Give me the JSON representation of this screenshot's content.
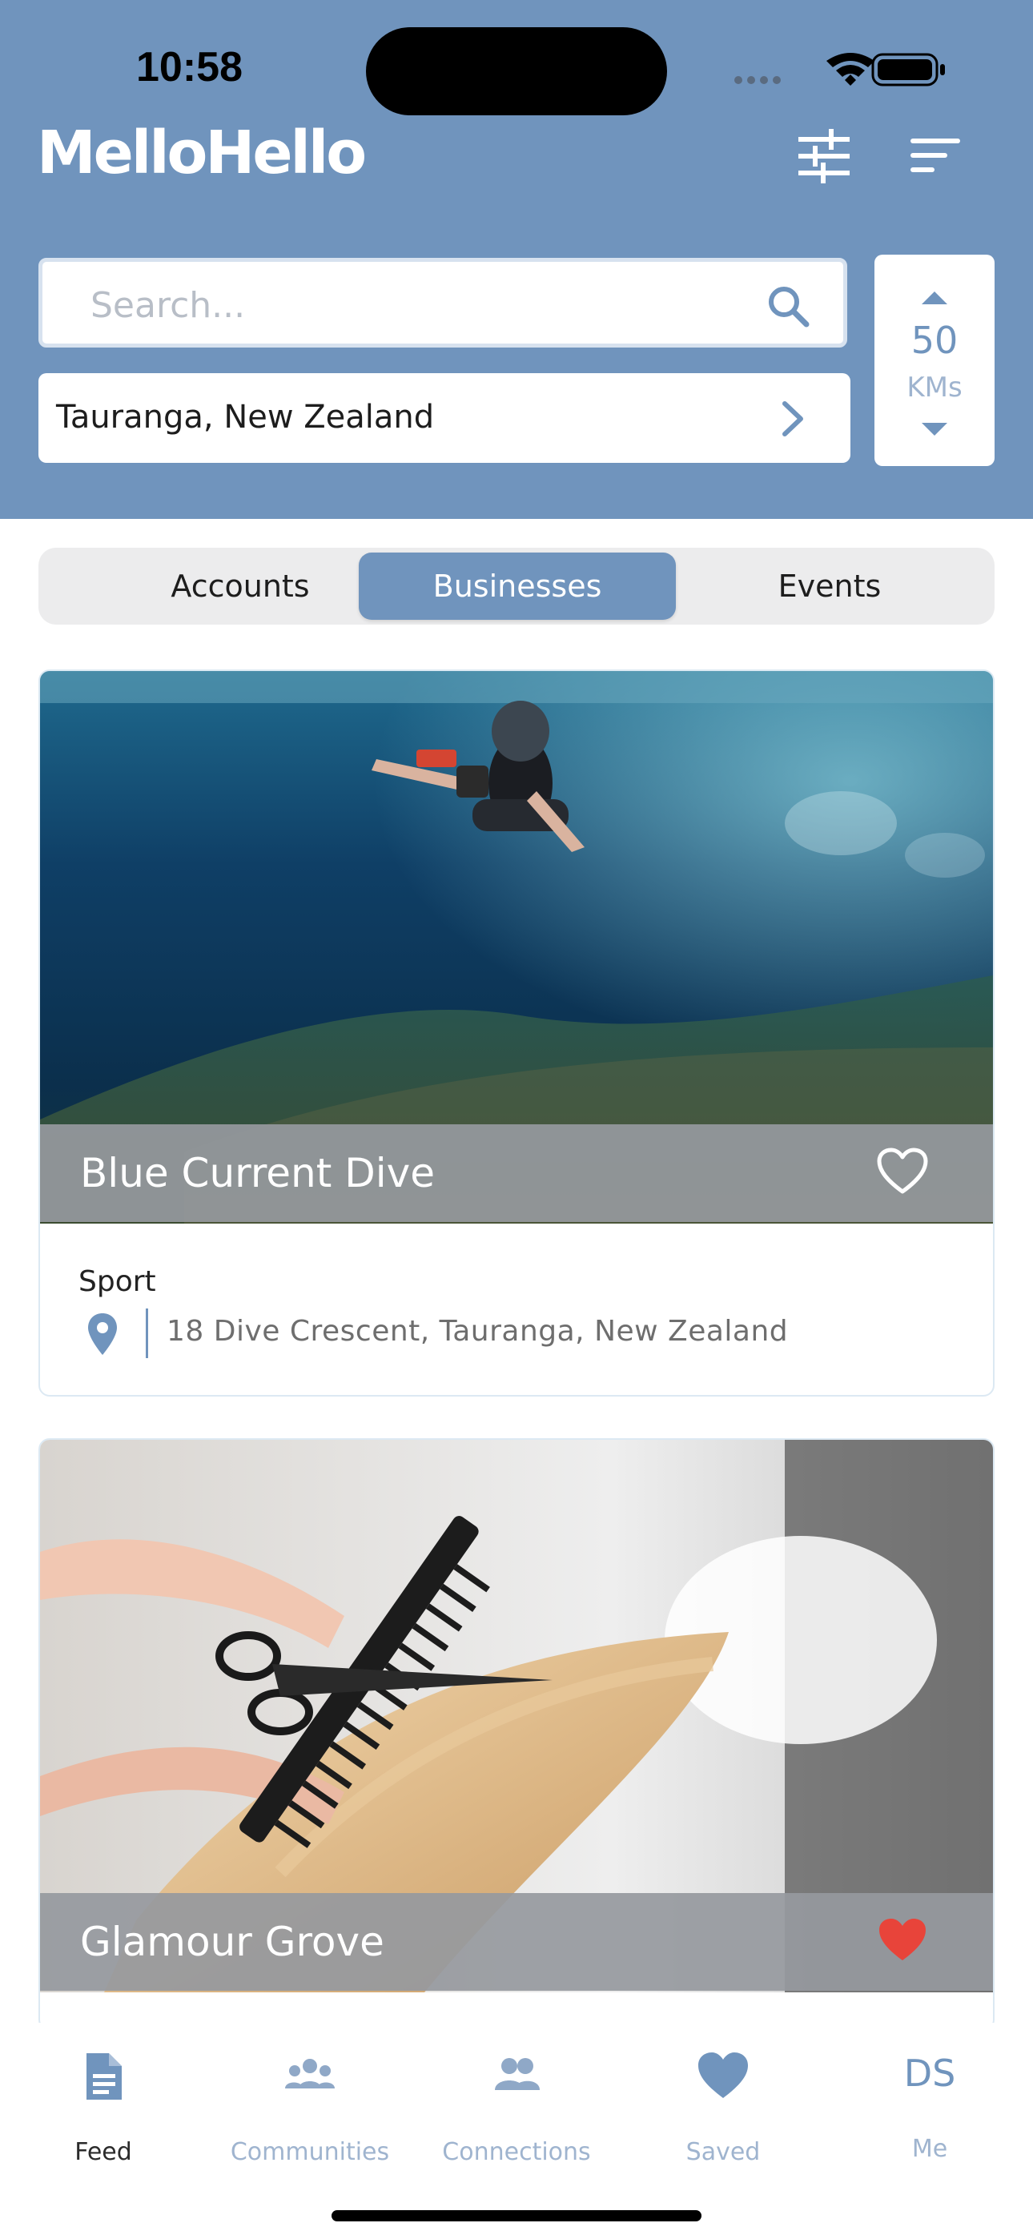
{
  "status_bar": {
    "time": "10:58"
  },
  "app": {
    "logo": "MelloHello"
  },
  "header_icons": [
    "sliders-icon",
    "sort-icon"
  ],
  "search": {
    "placeholder": "Search...",
    "value": ""
  },
  "location": {
    "text": "Tauranga, New Zealand"
  },
  "radius": {
    "value": "50",
    "unit": "KMs"
  },
  "tabs": [
    {
      "label": "Accounts",
      "active": false
    },
    {
      "label": "Businesses",
      "active": true
    },
    {
      "label": "Events",
      "active": false
    }
  ],
  "cards": [
    {
      "title": "Blue Current Dive",
      "category": "Sport",
      "address": "18 Dive Crescent, Tauranga, New Zealand",
      "saved": false,
      "image": "underwater-diver-photo"
    },
    {
      "title": "Glamour Grove",
      "saved": true,
      "image": "hair-cutting-photo"
    }
  ],
  "tabbar": [
    {
      "label": "Feed",
      "icon": "document-icon",
      "active": true
    },
    {
      "label": "Communities",
      "icon": "group-icon",
      "active": false
    },
    {
      "label": "Connections",
      "icon": "people-icon",
      "active": false
    },
    {
      "label": "Saved",
      "icon": "heart-icon",
      "active": false
    },
    {
      "label": "Me",
      "initials": "DS",
      "active": false
    }
  ],
  "colors": {
    "brand": "#7094bd",
    "heart_active": "#e8443a",
    "muted_label": "#9fb4cf"
  }
}
